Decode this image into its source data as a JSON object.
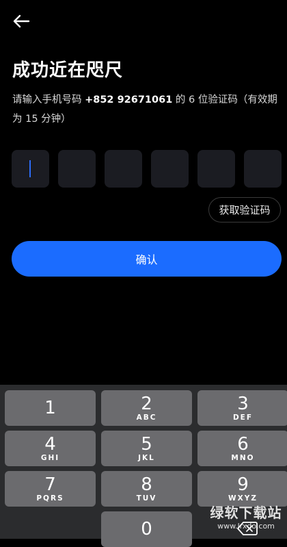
{
  "header": {
    "back_icon": "arrow-left-icon"
  },
  "title": "成功近在咫尺",
  "subtitle": {
    "prefix": "请输入手机号码 ",
    "phone": "+852 92671061",
    "suffix": " 的 6 位验证码（有效期为 15 分钟）"
  },
  "code_boxes": [
    "",
    "",
    "",
    "",
    "",
    ""
  ],
  "get_code_label": "获取验证码",
  "confirm_label": "确认",
  "keyboard": {
    "keys": [
      {
        "digit": "1",
        "letters": ""
      },
      {
        "digit": "2",
        "letters": "ABC"
      },
      {
        "digit": "3",
        "letters": "DEF"
      },
      {
        "digit": "4",
        "letters": "GHI"
      },
      {
        "digit": "5",
        "letters": "JKL"
      },
      {
        "digit": "6",
        "letters": "MNO"
      },
      {
        "digit": "7",
        "letters": "PQRS"
      },
      {
        "digit": "8",
        "letters": "TUV"
      },
      {
        "digit": "9",
        "letters": "WXYZ"
      },
      {
        "digit": "0",
        "letters": ""
      }
    ],
    "delete_icon": "backspace-icon"
  },
  "watermark": {
    "main": "绿软下载站",
    "sub": "www.lrxdo.com"
  },
  "colors": {
    "accent": "#1b6cff",
    "background": "#000000",
    "key": "#6b6b6e",
    "keyboard_bg": "#2b2c2e"
  }
}
